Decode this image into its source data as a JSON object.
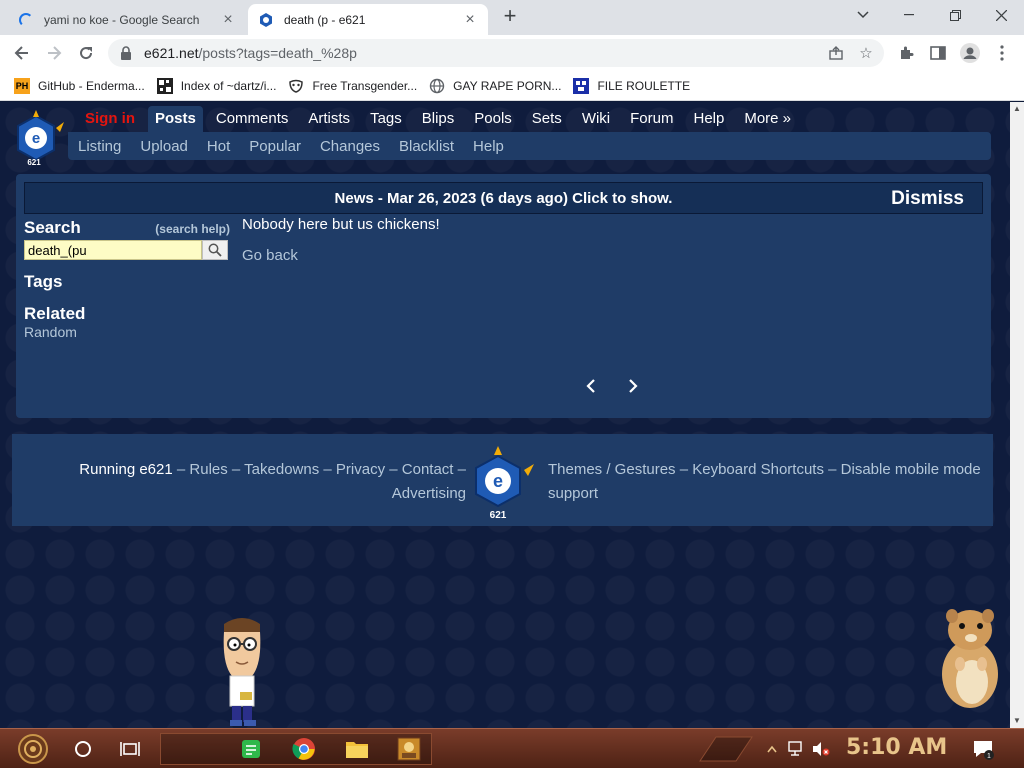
{
  "browser": {
    "tabs": [
      {
        "title": "yami no koe - Google Search",
        "active": false,
        "loading": true
      },
      {
        "title": "death (p - e621",
        "active": true,
        "loading": false
      }
    ],
    "url_host": "e621.net",
    "url_path": "/posts?tags=death_%28p",
    "bookmarks": [
      {
        "label": "GitHub - Enderma...",
        "icon": "ph-favicon"
      },
      {
        "label": "Index of ~dartz/i...",
        "icon": "qr-favicon"
      },
      {
        "label": "Free Transgender...",
        "icon": "mask-favicon"
      },
      {
        "label": "GAY RAPE PORN...",
        "icon": "globe-icon"
      },
      {
        "label": "FILE ROULETTE",
        "icon": "file-roulette-favicon"
      }
    ]
  },
  "site": {
    "top_nav": [
      {
        "label": "Sign in",
        "style": "signin"
      },
      {
        "label": "Posts",
        "style": "active"
      },
      {
        "label": "Comments",
        "style": ""
      },
      {
        "label": "Artists",
        "style": ""
      },
      {
        "label": "Tags",
        "style": ""
      },
      {
        "label": "Blips",
        "style": ""
      },
      {
        "label": "Pools",
        "style": ""
      },
      {
        "label": "Sets",
        "style": ""
      },
      {
        "label": "Wiki",
        "style": ""
      },
      {
        "label": "Forum",
        "style": ""
      },
      {
        "label": "Help",
        "style": ""
      },
      {
        "label": "More »",
        "style": ""
      }
    ],
    "sub_nav": [
      "Listing",
      "Upload",
      "Hot",
      "Popular",
      "Changes",
      "Blacklist",
      "Help"
    ],
    "news": {
      "text": "News - Mar 26, 2023 (6 days ago) Click to show.",
      "dismiss": "Dismiss"
    },
    "sidebar": {
      "search_title": "Search",
      "search_help": "(search help)",
      "search_value": "death_(pu",
      "tags_title": "Tags",
      "related_title": "Related",
      "random_link": "Random"
    },
    "results": {
      "empty_message": "Nobody here but us chickens!",
      "go_back": "Go back",
      "prev": "‹",
      "next": "›"
    },
    "footer": {
      "running": "Running e621",
      "left_links": [
        "Rules",
        "Takedowns",
        "Privacy",
        "Contact",
        "Advertising"
      ],
      "right_links": [
        "Themes / Gestures",
        "Keyboard Shortcuts",
        "Disable mobile mode",
        "support"
      ],
      "separator": "–"
    },
    "logo_text": "e621"
  },
  "taskbar": {
    "clock": "5:10 AM"
  },
  "colors": {
    "page_bg": "#0f1c3d",
    "panel": "#1f3c67",
    "link": "#b4c7d9",
    "signin": "#e4150f",
    "search_bg": "#fdfcc5"
  }
}
